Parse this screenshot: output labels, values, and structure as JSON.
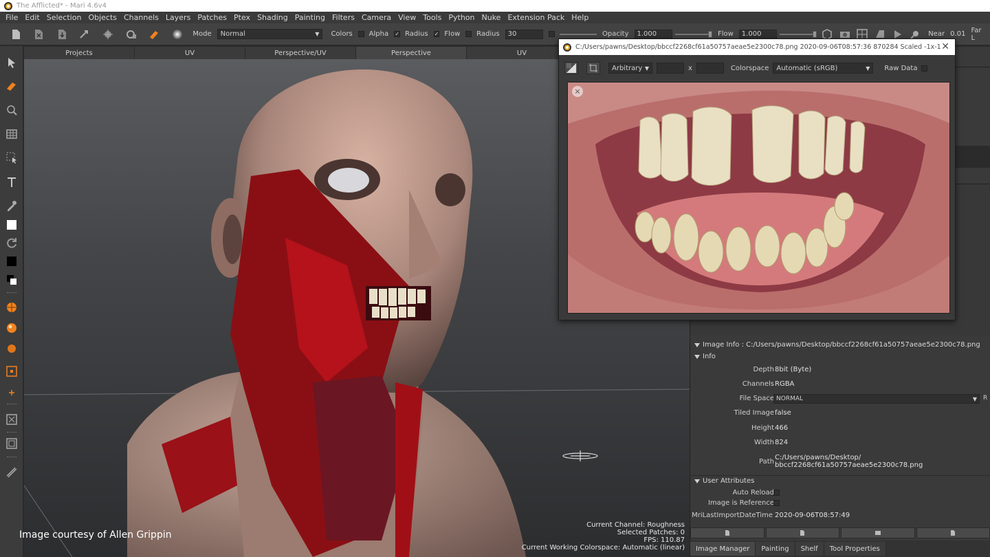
{
  "window": {
    "title": "The Afflicted* - Mari 4.6v4"
  },
  "menu": [
    "File",
    "Edit",
    "Selection",
    "Objects",
    "Channels",
    "Layers",
    "Patches",
    "Ptex",
    "Shading",
    "Painting",
    "Filters",
    "Camera",
    "View",
    "Tools",
    "Python",
    "Nuke",
    "Extension Pack",
    "Help"
  ],
  "toolbar": {
    "mode_label": "Mode",
    "mode_value": "Normal",
    "colors_label": "Colors",
    "alpha_label": "Alpha",
    "radius_label": "Radius",
    "flow_label": "Flow",
    "radius2_label": "Radius",
    "radius2_value": "30",
    "opacity_label": "Opacity",
    "opacity_value": "1.000",
    "flow2_label": "Flow",
    "flow2_value": "1.000",
    "near_label": "Near",
    "near_value": "0.01",
    "far_label": "Far L"
  },
  "viewtabs": [
    {
      "label": "Projects",
      "active": false
    },
    {
      "label": "UV",
      "active": false
    },
    {
      "label": "Perspective/UV",
      "active": false
    },
    {
      "label": "Perspective",
      "active": true
    },
    {
      "label": "UV",
      "active": false
    }
  ],
  "viewport": {
    "credit": "Image courtesy of Allen Grippin",
    "status": [
      "Current Channel: Roughness",
      "Selected Patches: 0",
      "FPS: 110.87",
      "Current Working Colorspace: Automatic (linear)"
    ]
  },
  "viewer": {
    "title": "C:/Users/pawns/Desktop/bbccf2268cf61a50757aeae5e2300c78.png 2020-09-06T08:57:36 870284 Scaled -1x-1",
    "filter_value": "Arbitrary",
    "times": "x",
    "colorspace_label": "Colorspace",
    "colorspace_value": "Automatic (sRGB)",
    "raw_label": "Raw Data"
  },
  "imageinfo": {
    "header": "Image Info : C:/Users/pawns/Desktop/bbccf2268cf61a50757aeae5e2300c78.png",
    "info_section": "Info",
    "rows": [
      {
        "label": "Depth",
        "value": "8bit  (Byte)"
      },
      {
        "label": "Channels",
        "value": "RGBA"
      },
      {
        "label": "File Space",
        "value": "NORMAL"
      },
      {
        "label": "Tiled Image",
        "value": "false"
      },
      {
        "label": "Height",
        "value": "466"
      },
      {
        "label": "Width",
        "value": "824"
      },
      {
        "label": "Path",
        "value": "C:/Users/pawns/Desktop/",
        "value2": "bbccf2268cf61a50757aeae5e2300c78.png"
      }
    ],
    "user_section": "User Attributes",
    "user_rows": [
      {
        "label": "Auto Reload"
      },
      {
        "label": "Image is Reference"
      },
      {
        "label": "MriLastImportDateTime",
        "value": "2020-09-06T08:57:49"
      }
    ],
    "file_space_extra": "R"
  },
  "bottomtabs": [
    {
      "label": "Image Manager",
      "active": true
    },
    {
      "label": "Painting",
      "active": false
    },
    {
      "label": "Shelf",
      "active": false
    },
    {
      "label": "Tool Properties",
      "active": false
    }
  ],
  "colors": {
    "accent": "#f0821e",
    "bg": "#2b2b2b",
    "panel": "#3a3a3a"
  }
}
